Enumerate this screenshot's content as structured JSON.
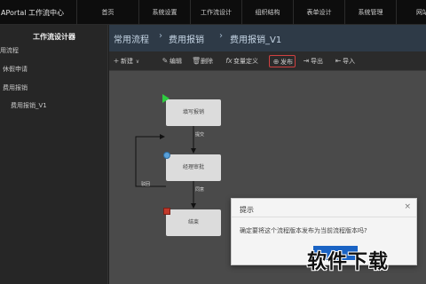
{
  "app": {
    "title": "APortal 工作流中心"
  },
  "nav": [
    "首页",
    "系统设置",
    "工作流设计",
    "组织结构",
    "表单设计",
    "系统管理",
    "网站"
  ],
  "sidebar": {
    "title": "工作流设计器",
    "items": [
      "用流程",
      "休假申请",
      "费用报销",
      "费用报销_V1"
    ]
  },
  "breadcrumb": [
    "常用流程",
    "费用报销",
    "费用报销_V1"
  ],
  "toolbar": {
    "new_label": "新建",
    "edit_label": "编辑",
    "delete_label": "删除",
    "variable_label": "变量定义",
    "publish_label": "发布",
    "export_label": "导出",
    "import_label": "导入"
  },
  "flow": {
    "nodes": [
      "填写报销",
      "经理审批",
      "结束"
    ],
    "edges": [
      "提交",
      "同意",
      "驳回"
    ]
  },
  "dialog": {
    "title": "提示",
    "message": "确定要将这个流程版本发布为当前流程版本吗?"
  },
  "watermark": "软件下载",
  "colors": {
    "topbar": "#0d0d0d",
    "breadcrumb": "#2e3a47",
    "start_node": "#2ecc40",
    "end_node": "#c0392b",
    "primary_button": "#1a63c4",
    "publish_highlight": "#d04040"
  }
}
